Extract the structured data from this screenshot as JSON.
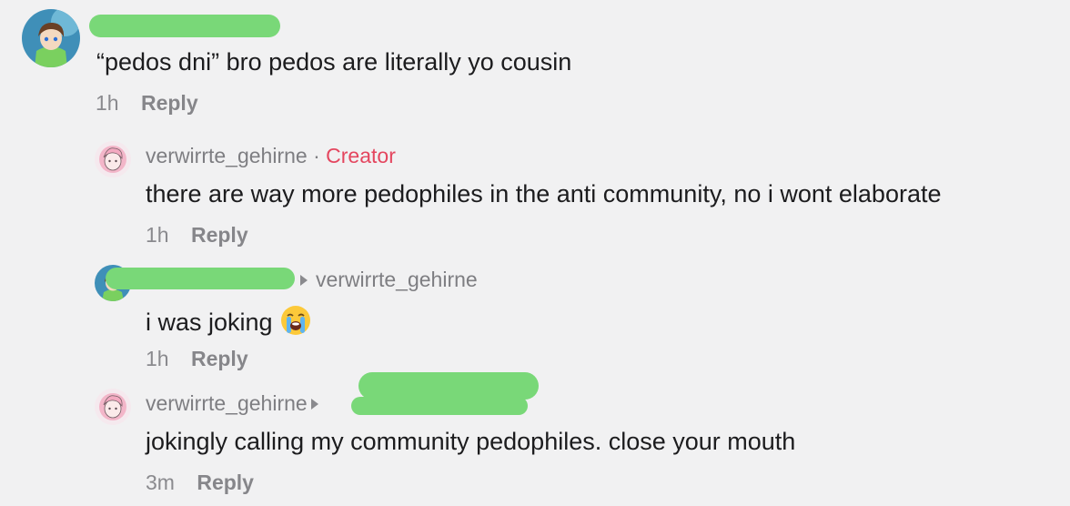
{
  "comments": [
    {
      "text": "“pedos dni” bro pedos are literally yo cousin",
      "time": "1h",
      "reply": "Reply"
    },
    {
      "username": "verwirrte_gehirne",
      "separator": "·",
      "badge": "Creator",
      "text": "there are way more pedophiles in the anti community, no i wont elaborate",
      "time": "1h",
      "reply": "Reply"
    },
    {
      "reply_to": "verwirrte_gehirne",
      "text": "i was joking",
      "emoji": "loudly-crying-face",
      "time": "1h",
      "reply": "Reply"
    },
    {
      "username": "verwirrte_gehirne",
      "text": "jokingly calling my community pedophiles. close your mouth",
      "time": "3m",
      "reply": "Reply"
    }
  ],
  "colors": {
    "background": "#f1f1f2",
    "redaction": "#79d878",
    "creator_badge": "#e4465f",
    "text": "#1c1c1e",
    "muted": "#8a8a8e"
  }
}
